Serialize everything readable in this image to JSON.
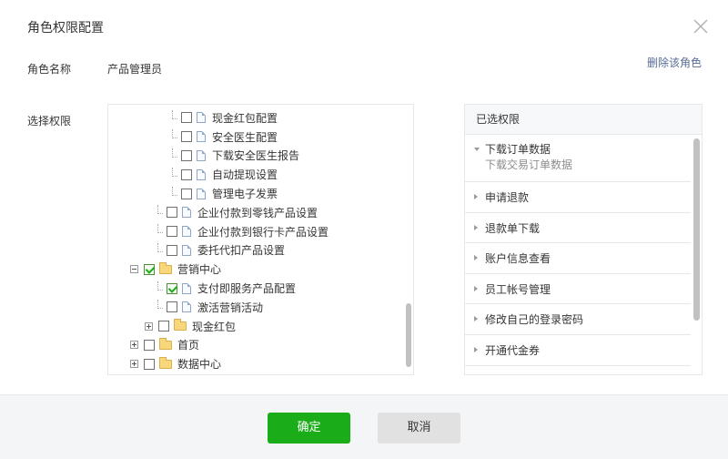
{
  "dialog": {
    "title": "角色权限配置",
    "role_label": "角色名称",
    "role_value": "产品管理员",
    "delete_link": "删除该角色",
    "perm_label": "选择权限"
  },
  "tree": [
    {
      "label": "现金红包配置",
      "icon": "file-icon",
      "checked": false,
      "expander": null
    },
    {
      "label": "安全医生配置",
      "icon": "file-icon",
      "checked": false,
      "expander": null
    },
    {
      "label": "下载安全医生报告",
      "icon": "file-icon",
      "checked": false,
      "expander": null
    },
    {
      "label": "自动提现设置",
      "icon": "file-icon",
      "checked": false,
      "expander": null
    },
    {
      "label": "管理电子发票",
      "icon": "file-icon",
      "checked": false,
      "expander": null
    },
    {
      "label": "企业付款到零钱产品设置",
      "icon": "file-icon",
      "checked": false,
      "expander": null
    },
    {
      "label": "企业付款到银行卡产品设置",
      "icon": "file-icon",
      "checked": false,
      "expander": null
    },
    {
      "label": "委托代扣产品设置",
      "icon": "file-icon",
      "checked": false,
      "expander": null
    },
    {
      "label": "营销中心",
      "icon": "folder-icon",
      "checked": true,
      "expander": "minus"
    },
    {
      "label": "支付即服务产品配置",
      "icon": "file-icon",
      "checked": true,
      "expander": null
    },
    {
      "label": "激活营销活动",
      "icon": "file-icon",
      "checked": false,
      "expander": null
    },
    {
      "label": "现金红包",
      "icon": "folder-icon",
      "checked": false,
      "expander": "plus"
    },
    {
      "label": "首页",
      "icon": "folder-icon",
      "checked": false,
      "expander": "plus"
    },
    {
      "label": "数据中心",
      "icon": "folder-icon",
      "checked": false,
      "expander": "plus"
    }
  ],
  "selected": {
    "header": "已选权限",
    "items": [
      {
        "label": "下载订单数据",
        "sub": "下载交易订单数据",
        "expanded": true
      },
      {
        "label": "申请退款",
        "sub": "",
        "expanded": false
      },
      {
        "label": "退款单下载",
        "sub": "",
        "expanded": false
      },
      {
        "label": "账户信息查看",
        "sub": "",
        "expanded": false
      },
      {
        "label": "员工帐号管理",
        "sub": "",
        "expanded": false
      },
      {
        "label": "修改自己的登录密码",
        "sub": "",
        "expanded": false
      },
      {
        "label": "开通代金券",
        "sub": "",
        "expanded": false
      }
    ]
  },
  "buttons": {
    "ok": "确定",
    "cancel": "取消"
  },
  "colors": {
    "primary": "#1aad19",
    "link": "#576b95",
    "border": "#e4e8eb"
  }
}
